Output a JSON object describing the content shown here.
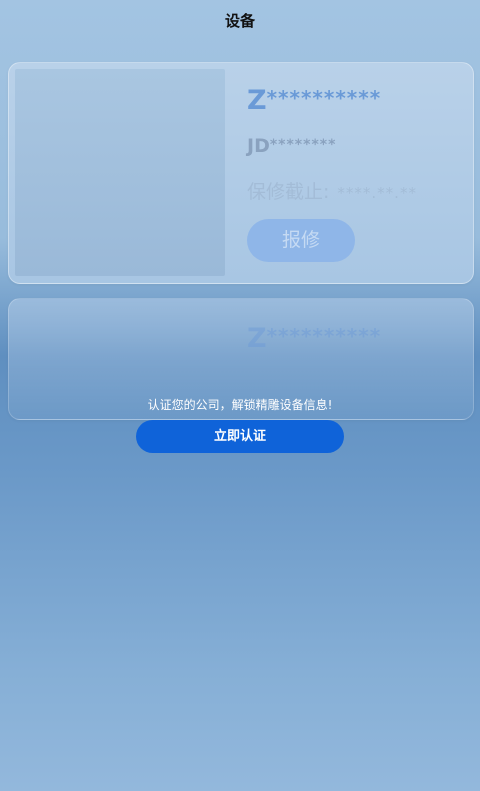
{
  "header": {
    "title": "设备"
  },
  "devices": [
    {
      "name_prefix": "Z",
      "name_masked": "**********",
      "code_prefix": "JD",
      "code_masked": "********",
      "warranty_label": "保修截止:",
      "warranty_value": "****.**.**",
      "repair_label": "报修"
    },
    {
      "name_prefix": "Z",
      "name_masked": "**********"
    }
  ],
  "overlay": {
    "hint": "认证您的公司，解锁精雕设备信息!",
    "auth_button": "立即认证"
  },
  "colors": {
    "accent": "#0f63d9",
    "device_name": "#6a9ad7"
  }
}
